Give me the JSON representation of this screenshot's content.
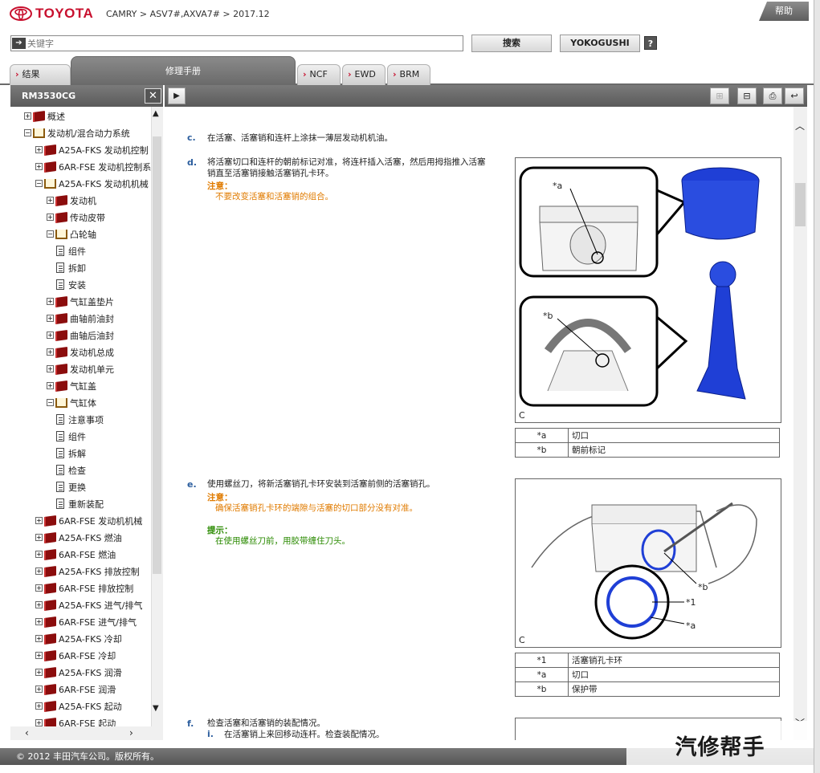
{
  "header": {
    "brand": "TOYOTA",
    "breadcrumb": "CAMRY > ASV7#,AXVA7# > 2017.12",
    "help_label": "帮助"
  },
  "search": {
    "placeholder": "关键字",
    "search_button": "搜索",
    "yokogushi_button": "YOKOGUSHI",
    "help_button": "?"
  },
  "tabs": [
    {
      "label": "结果"
    },
    {
      "label": "修理手册"
    },
    {
      "label": "NCF"
    },
    {
      "label": "EWD"
    },
    {
      "label": "BRM"
    }
  ],
  "panel": {
    "title": "RM3530CG",
    "close": "✕"
  },
  "tree": [
    {
      "label": "概述",
      "level": 1,
      "kind": "book",
      "exp": "+"
    },
    {
      "label": "发动机/混合动力系统",
      "level": 1,
      "kind": "open",
      "exp": "−"
    },
    {
      "label": "A25A-FKS 发动机控制",
      "level": 2,
      "kind": "book",
      "exp": "+"
    },
    {
      "label": "6AR-FSE 发动机控制系",
      "level": 2,
      "kind": "book",
      "exp": "+"
    },
    {
      "label": "A25A-FKS 发动机机械",
      "level": 2,
      "kind": "open",
      "exp": "−"
    },
    {
      "label": "发动机",
      "level": 3,
      "kind": "book",
      "exp": "+"
    },
    {
      "label": "传动皮带",
      "level": 3,
      "kind": "book",
      "exp": "+"
    },
    {
      "label": "凸轮轴",
      "level": 3,
      "kind": "open",
      "exp": "−"
    },
    {
      "label": "组件",
      "level": 4,
      "kind": "doc"
    },
    {
      "label": "拆卸",
      "level": 4,
      "kind": "doc"
    },
    {
      "label": "安装",
      "level": 4,
      "kind": "doc"
    },
    {
      "label": "气缸盖垫片",
      "level": 3,
      "kind": "book",
      "exp": "+"
    },
    {
      "label": "曲轴前油封",
      "level": 3,
      "kind": "book",
      "exp": "+"
    },
    {
      "label": "曲轴后油封",
      "level": 3,
      "kind": "book",
      "exp": "+"
    },
    {
      "label": "发动机总成",
      "level": 3,
      "kind": "book",
      "exp": "+"
    },
    {
      "label": "发动机单元",
      "level": 3,
      "kind": "book",
      "exp": "+"
    },
    {
      "label": "气缸盖",
      "level": 3,
      "kind": "book",
      "exp": "+"
    },
    {
      "label": "气缸体",
      "level": 3,
      "kind": "open",
      "exp": "−"
    },
    {
      "label": "注意事项",
      "level": 4,
      "kind": "doc"
    },
    {
      "label": "组件",
      "level": 4,
      "kind": "doc"
    },
    {
      "label": "拆解",
      "level": 4,
      "kind": "doc"
    },
    {
      "label": "检查",
      "level": 4,
      "kind": "doc"
    },
    {
      "label": "更换",
      "level": 4,
      "kind": "doc"
    },
    {
      "label": "重新装配",
      "level": 4,
      "kind": "doc"
    },
    {
      "label": "6AR-FSE 发动机机械",
      "level": 2,
      "kind": "book",
      "exp": "+"
    },
    {
      "label": "A25A-FKS 燃油",
      "level": 2,
      "kind": "book",
      "exp": "+"
    },
    {
      "label": "6AR-FSE 燃油",
      "level": 2,
      "kind": "book",
      "exp": "+"
    },
    {
      "label": "A25A-FKS 排放控制",
      "level": 2,
      "kind": "book",
      "exp": "+"
    },
    {
      "label": "6AR-FSE 排放控制",
      "level": 2,
      "kind": "book",
      "exp": "+"
    },
    {
      "label": "A25A-FKS 进气/排气",
      "level": 2,
      "kind": "book",
      "exp": "+"
    },
    {
      "label": "6AR-FSE 进气/排气",
      "level": 2,
      "kind": "book",
      "exp": "+"
    },
    {
      "label": "A25A-FKS 冷却",
      "level": 2,
      "kind": "book",
      "exp": "+"
    },
    {
      "label": "6AR-FSE 冷却",
      "level": 2,
      "kind": "book",
      "exp": "+"
    },
    {
      "label": "A25A-FKS 润滑",
      "level": 2,
      "kind": "book",
      "exp": "+"
    },
    {
      "label": "6AR-FSE 润滑",
      "level": 2,
      "kind": "book",
      "exp": "+"
    },
    {
      "label": "A25A-FKS 起动",
      "level": 2,
      "kind": "book",
      "exp": "+"
    },
    {
      "label": "6AR-FSE 起动",
      "level": 2,
      "kind": "book",
      "exp": "+"
    }
  ],
  "content": {
    "step_c": {
      "letter": "c.",
      "text": "在活塞、活塞销和连杆上涂抹一薄层发动机机油。"
    },
    "step_d": {
      "letter": "d.",
      "text1": "将活塞切口和连杆的朝前标记对准，将连杆插入活塞，然后用拇指推入活塞",
      "text2": "销直至活塞销接触活塞销孔卡环。",
      "note_label": "注意：",
      "note_text": "不要改变活塞和活塞销的组合。",
      "fig_labels": {
        "a": "*a",
        "b": "*b",
        "c": "C"
      },
      "legend": [
        {
          "key": "*a",
          "value": "切口"
        },
        {
          "key": "*b",
          "value": "朝前标记"
        }
      ]
    },
    "step_e": {
      "letter": "e.",
      "text": "使用螺丝刀，将新活塞销孔卡环安装到活塞前侧的活塞销孔。",
      "note_label": "注意：",
      "note_text": "确保活塞销孔卡环的端隙与活塞的切口部分没有对准。",
      "hint_label": "提示：",
      "hint_text": "在使用螺丝刀前，用胶带缠住刀头。",
      "fig_labels": {
        "b": "*b",
        "one": "*1",
        "a": "*a",
        "c": "C"
      },
      "legend": [
        {
          "key": "*1",
          "value": "活塞销孔卡环"
        },
        {
          "key": "*a",
          "value": "切口"
        },
        {
          "key": "*b",
          "value": "保护带"
        }
      ]
    },
    "step_f": {
      "letter": "f.",
      "text": "检查活塞和活塞销的装配情况。",
      "sub_letter": "i.",
      "sub_text": "在活塞销上来回移动连杆。检查装配情况。"
    }
  },
  "footer": {
    "text": "© 2012 丰田汽车公司。版权所有。"
  },
  "watermark": {
    "text": "汽修帮手"
  },
  "colors": {
    "brand": "#c8102e",
    "note": "#e07b00",
    "hint": "#2a8a00",
    "step": "#2c5e9e",
    "part_blue": "#1f3fd6"
  }
}
